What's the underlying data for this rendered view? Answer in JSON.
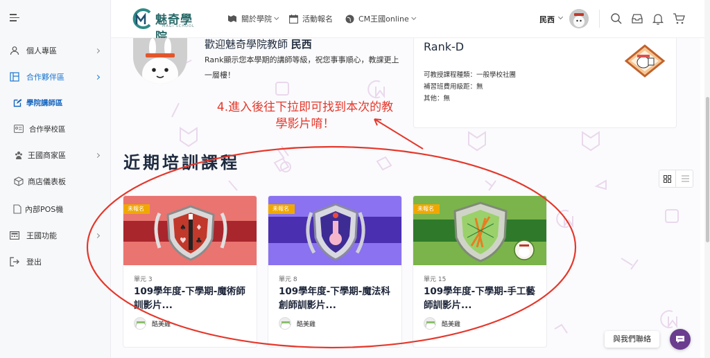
{
  "brand": {
    "name": "魅奇學院",
    "subtitle": "MAGI SCHOOL",
    "colors": {
      "accent": "#1976d2",
      "annotation": "#e5372b",
      "badge": "#f0a800"
    }
  },
  "header": {
    "nav": [
      {
        "label": "關於學院",
        "icon": "book-icon",
        "has_caret": true
      },
      {
        "label": "活動報名",
        "icon": "calendar-icon",
        "has_caret": false
      },
      {
        "label": "CM王國online",
        "icon": "globe-icon",
        "has_caret": true
      }
    ],
    "user_name": "民西",
    "icons": [
      "search-icon",
      "inbox-icon",
      "bell-icon",
      "cart-icon"
    ]
  },
  "sidebar": {
    "items": [
      {
        "label": "個人專區",
        "icon": "user-icon",
        "has_chevron": true
      },
      {
        "label": "合作夥伴區",
        "icon": "layout-icon",
        "has_chevron": true
      },
      {
        "label": "學院講師區",
        "icon": "edit-icon",
        "has_chevron": false
      },
      {
        "label": "合作學校區",
        "icon": "id-card-icon",
        "has_chevron": false
      },
      {
        "label": "王國商家區",
        "icon": "people-icon",
        "has_chevron": true
      },
      {
        "label": "商店儀表板",
        "icon": "box-icon",
        "has_chevron": false
      },
      {
        "label": "內部POS機",
        "icon": "document-icon",
        "has_chevron": false
      },
      {
        "label": "王國功能",
        "icon": "calculator-icon",
        "has_chevron": true
      },
      {
        "label": "登出",
        "icon": "logout-icon",
        "has_chevron": false
      }
    ]
  },
  "welcome": {
    "title_prefix": "歡迎魅奇學院教師",
    "title_name": "民西",
    "body": "Rank顯示您本學期的講師等級，祝您事事順心，教課更上一層樓！"
  },
  "rank_card": {
    "rank": "Rank-D",
    "lines": [
      "可教授課程種類：一般學校社團",
      "補習班費用級距：無",
      "其他：無"
    ]
  },
  "annotation": {
    "text": "4.進入後往下拉即可找到本次的教學影片唷！"
  },
  "section": {
    "title": "近期培訓課程"
  },
  "courses": [
    {
      "badge": "未報名",
      "unit": "單元 3",
      "title": "109學年度-下學期-魔術師訓影片...",
      "author": "酷美雞",
      "theme_color": "#e86a66",
      "band_color": "#a8262c"
    },
    {
      "badge": "未報名",
      "unit": "單元 8",
      "title": "109學年度-下學期-魔法科創師訓影片...",
      "author": "酷美雞",
      "theme_color": "#8a72f0",
      "band_color": "#4a2fb0"
    },
    {
      "badge": "未報名",
      "unit": "單元 15",
      "title": "109學年度-下學期-手工藝師訓影片...",
      "author": "酷美雞",
      "theme_color": "#7bb44a",
      "band_color": "#2e7a2a"
    }
  ],
  "contact": {
    "label": "與我們聯絡"
  }
}
